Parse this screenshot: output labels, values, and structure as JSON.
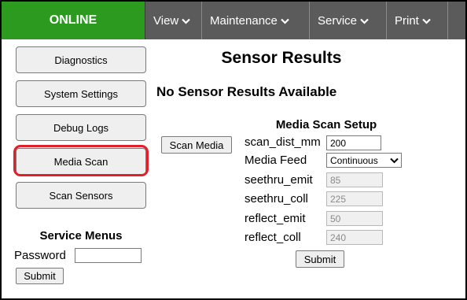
{
  "nav": {
    "status": "ONLINE",
    "menus": [
      {
        "label": "View"
      },
      {
        "label": "Maintenance"
      },
      {
        "label": "Service"
      },
      {
        "label": "Print"
      }
    ]
  },
  "sidebar": {
    "buttons": [
      {
        "label": "Diagnostics"
      },
      {
        "label": "System Settings"
      },
      {
        "label": "Debug Logs"
      },
      {
        "label": "Media Scan"
      },
      {
        "label": "Scan Sensors"
      }
    ],
    "service_menus": {
      "title": "Service Menus",
      "password_label": "Password",
      "password_value": "",
      "submit_label": "Submit"
    }
  },
  "main": {
    "title": "Sensor Results",
    "no_results": "No Sensor Results Available",
    "scan_media_label": "Scan Media",
    "setup": {
      "title": "Media Scan Setup",
      "fields": [
        {
          "label": "scan_dist_mm",
          "value": "200"
        },
        {
          "label": "Media Feed",
          "value": "Continuous"
        },
        {
          "label": "seethru_emit",
          "value": "85"
        },
        {
          "label": "seethru_coll",
          "value": "225"
        },
        {
          "label": "reflect_emit",
          "value": "50"
        },
        {
          "label": "reflect_coll",
          "value": "240"
        }
      ],
      "submit_label": "Submit"
    }
  },
  "colors": {
    "status_bg": "#2b9a1f",
    "nav_bg": "#5b5b5b",
    "highlight": "#e3202a"
  }
}
